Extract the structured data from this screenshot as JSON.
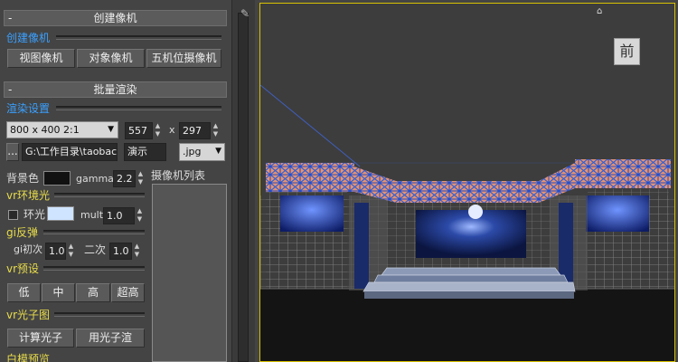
{
  "create_camera": {
    "rollout_title": "创建像机",
    "collapse_symbol": "-",
    "section_label": "创建像机",
    "buttons": [
      "视图像机",
      "对象像机",
      "五机位摄像机"
    ]
  },
  "batch_render": {
    "rollout_title": "批量渲染",
    "collapse_symbol": "-",
    "render_settings_label": "渲染设置",
    "resolution_preset": "800 x 400 2:1",
    "width": "557",
    "times": "x",
    "height": "297",
    "browse_button": "...",
    "output_path": "G:\\工作目录\\taobac",
    "file_name": "演示",
    "format": ".jpg",
    "bg_label": "背景色",
    "bg_color": "#111111",
    "gamma_label": "gamma",
    "gamma_value": "2.2",
    "camera_list_label": "摄像机列表",
    "vr_env_label": "vr环境光",
    "ambient_label": "环光",
    "ambient_color": "#cfe4ff",
    "mult_label": "mult",
    "mult_value": "1.0",
    "gi_label": "gi反弹",
    "gi_primary_label": "gi初次",
    "gi_primary_value": "1.0",
    "gi_secondary_label": "二次",
    "gi_secondary_value": "1.0",
    "vr_preset_label": "vr预设",
    "presets": [
      "低",
      "中",
      "高",
      "超高"
    ],
    "photon_label": "vr光子图",
    "calc_photon_button": "计算光子",
    "use_photon_button": "用光子渲",
    "next_section_label": "白模预览"
  },
  "viewport": {
    "viewcube_label": "前",
    "border_color": "#d8c000"
  },
  "icons": {
    "pin": "pin-icon",
    "home": "home-icon",
    "dropdown": "chevron-down-icon",
    "spinner": "spinner-icon"
  }
}
